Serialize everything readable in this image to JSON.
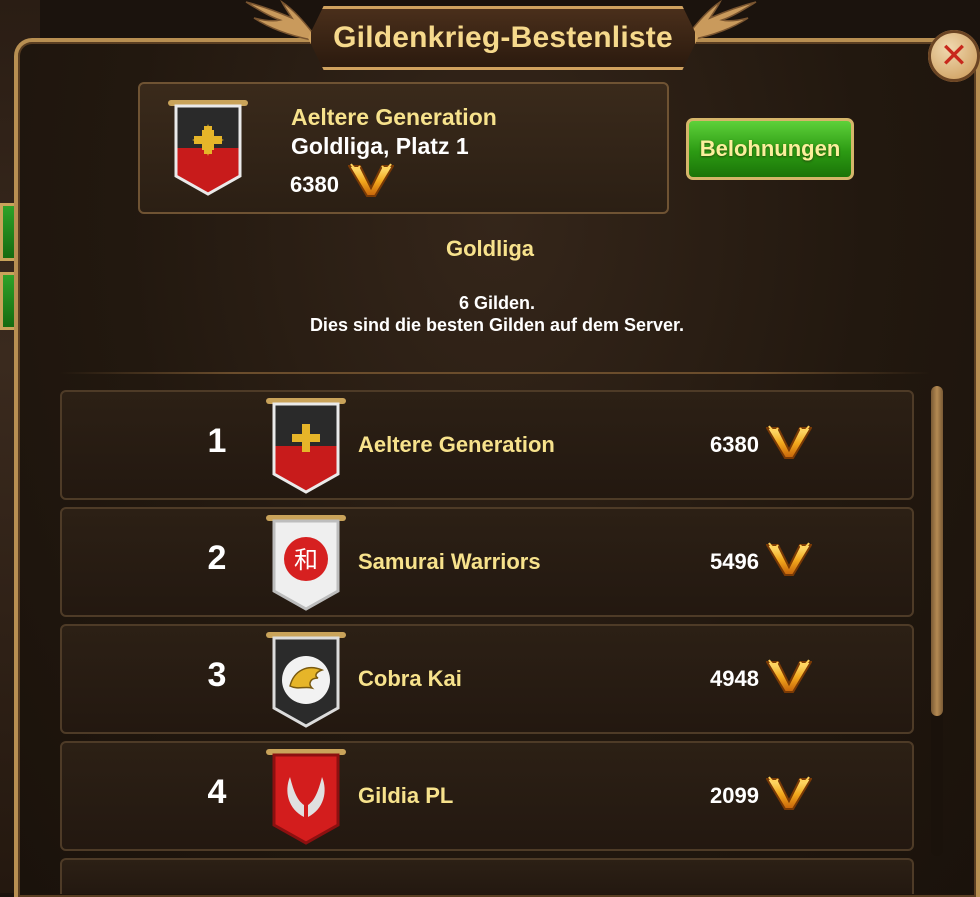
{
  "window": {
    "title": "Gildenkrieg-Bestenliste"
  },
  "my_guild": {
    "name": "Aeltere Generation",
    "league_line": "Goldliga, Platz 1",
    "points": "6380"
  },
  "rewards_button": {
    "label": "Belohnungen"
  },
  "league": {
    "title": "Goldliga",
    "count_text": "6 Gilden.",
    "description": "Dies sind die besten Gilden auf dem Server."
  },
  "rows": [
    {
      "rank": "1",
      "name": "Aeltere Generation",
      "points": "6380",
      "banner": "red-cross-banner"
    },
    {
      "rank": "2",
      "name": "Samurai Warriors",
      "points": "5496",
      "banner": "kanji-banner"
    },
    {
      "rank": "3",
      "name": "Cobra Kai",
      "points": "4948",
      "banner": "eagle-banner"
    },
    {
      "rank": "4",
      "name": "Gildia PL",
      "points": "2099",
      "banner": "wings-banner"
    }
  ],
  "colors": {
    "gold_text": "#f7e28c",
    "rewards_green": "#2c9a13",
    "frame": "#b88f52"
  }
}
